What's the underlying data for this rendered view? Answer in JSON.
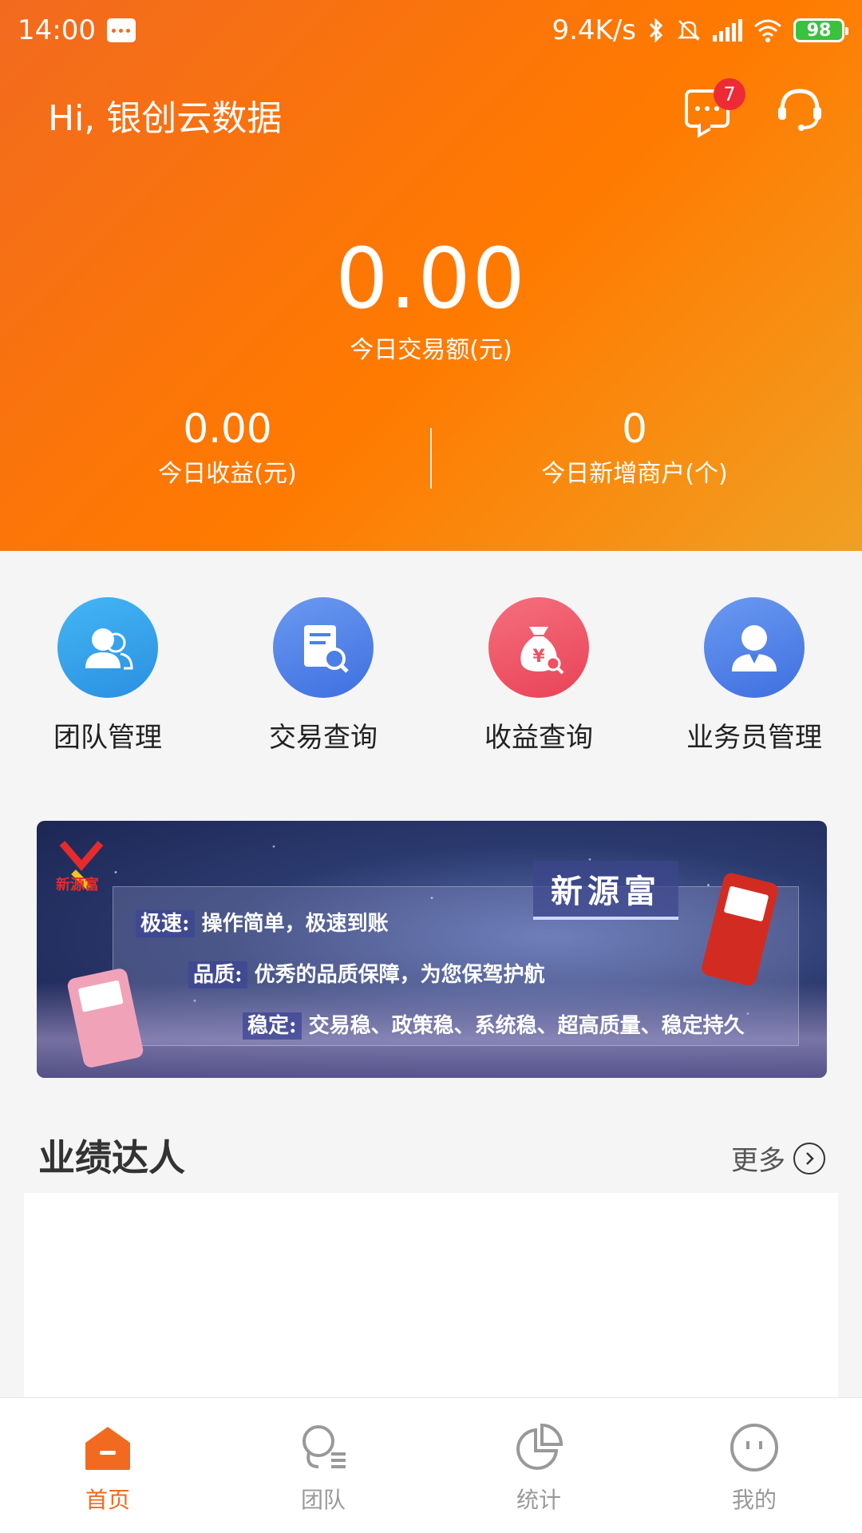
{
  "status_bar": {
    "time": "14:00",
    "network_speed": "9.4K/s",
    "battery": "98",
    "icons": [
      "message-icon",
      "bluetooth-icon",
      "mute-icon",
      "signal-icon",
      "wifi-icon",
      "battery-icon"
    ]
  },
  "header": {
    "greeting": "Hi, 银创云数据",
    "message_badge": "7",
    "colors": {
      "gradient_start": "#f26a1f",
      "gradient_mid": "#ff7a00",
      "gradient_end": "#f0a023"
    }
  },
  "summary": {
    "today_amount": "0.00",
    "today_amount_label": "今日交易额(元)",
    "today_income": "0.00",
    "today_income_label": "今日收益(元)",
    "new_merchants": "0",
    "new_merchants_label": "今日新增商户(个)"
  },
  "quick_menu": [
    {
      "label": "团队管理",
      "icon": "team-icon",
      "color": "#2f9be6"
    },
    {
      "label": "交易查询",
      "icon": "transaction-search-icon",
      "color": "#4a7fe6"
    },
    {
      "label": "收益查询",
      "icon": "money-bag-search-icon",
      "color": "#ee5064"
    },
    {
      "label": "业务员管理",
      "icon": "salesperson-icon",
      "color": "#4a7fe6"
    }
  ],
  "banner": {
    "brand": "新源富",
    "logo_text": "新源富",
    "line1_tag": "极速:",
    "line1_text": "操作简单，极速到账",
    "line2_tag": "品质:",
    "line2_text": "优秀的品质保障，为您保驾护航",
    "line3_tag": "稳定:",
    "line3_text": "交易稳、政策稳、系统稳、超高质量、稳定持久"
  },
  "performance": {
    "title": "业绩达人",
    "more_label": "更多"
  },
  "tabbar": {
    "active_color": "#f26a1f",
    "inactive_color": "#999999",
    "tabs": [
      {
        "label": "首页",
        "icon": "home-icon",
        "active": true
      },
      {
        "label": "团队",
        "icon": "team-tab-icon",
        "active": false
      },
      {
        "label": "统计",
        "icon": "pie-chart-icon",
        "active": false
      },
      {
        "label": "我的",
        "icon": "profile-face-icon",
        "active": false
      }
    ]
  }
}
